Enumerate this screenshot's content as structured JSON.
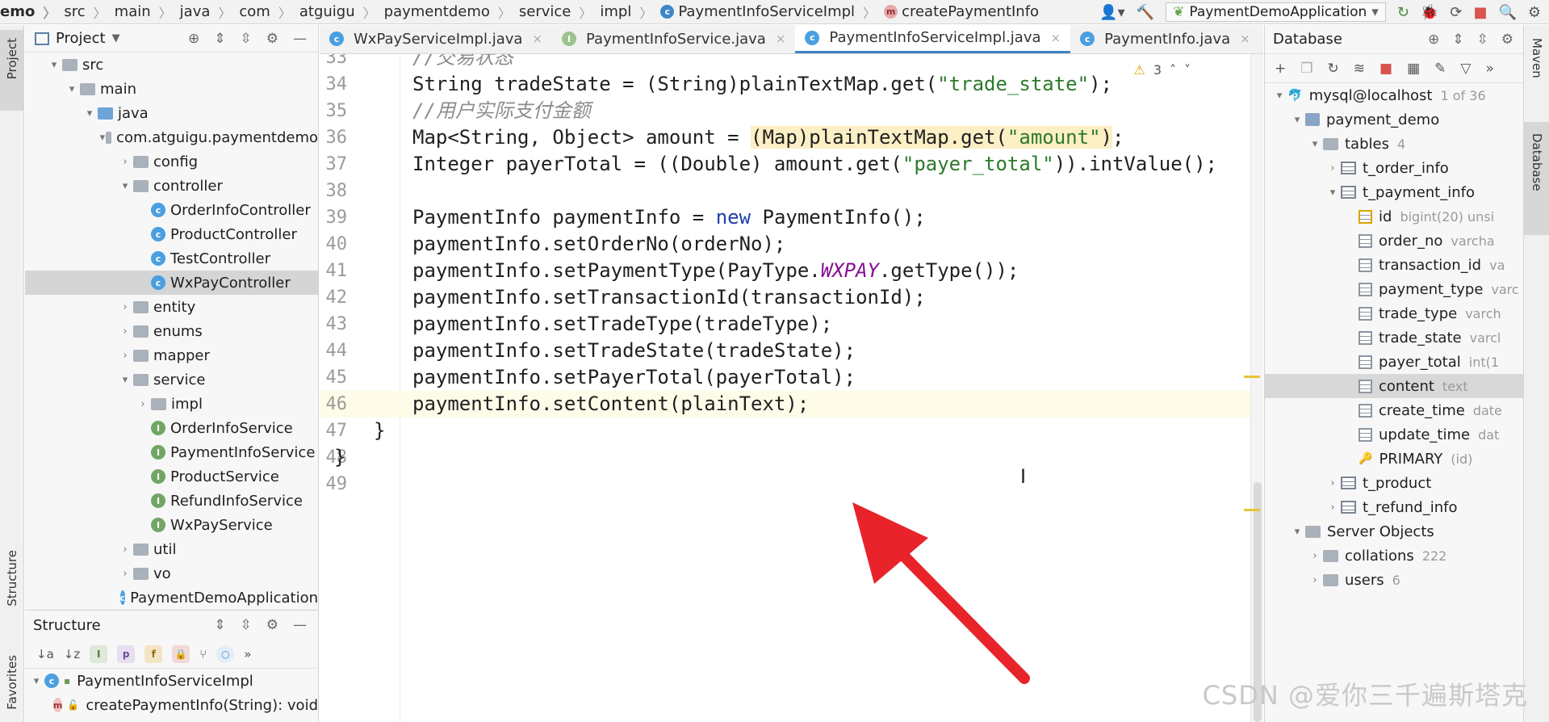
{
  "breadcrumb": [
    "emo",
    "src",
    "main",
    "java",
    "com",
    "atguigu",
    "paymentdemo",
    "service",
    "impl",
    "PaymentInfoServiceImpl",
    "createPaymentInfo"
  ],
  "run_config": "PaymentDemoApplication",
  "left_strip": {
    "project": "Project",
    "structure": "Structure",
    "favorites": "Favorites"
  },
  "right_strip": {
    "maven": "Maven",
    "database": "Database"
  },
  "project_panel": {
    "title": "Project",
    "tree": [
      {
        "label": "src",
        "depth": 0,
        "expanded": true,
        "kind": "folder"
      },
      {
        "label": "main",
        "depth": 1,
        "expanded": true,
        "kind": "folder"
      },
      {
        "label": "java",
        "depth": 2,
        "expanded": true,
        "kind": "folder-blue"
      },
      {
        "label": "com.atguigu.paymentdemo",
        "depth": 3,
        "expanded": true,
        "kind": "package"
      },
      {
        "label": "config",
        "depth": 4,
        "expanded": false,
        "kind": "package"
      },
      {
        "label": "controller",
        "depth": 4,
        "expanded": true,
        "kind": "package"
      },
      {
        "label": "OrderInfoController",
        "depth": 5,
        "kind": "class"
      },
      {
        "label": "ProductController",
        "depth": 5,
        "kind": "class"
      },
      {
        "label": "TestController",
        "depth": 5,
        "kind": "class"
      },
      {
        "label": "WxPayController",
        "depth": 5,
        "kind": "class",
        "selected": true
      },
      {
        "label": "entity",
        "depth": 4,
        "expanded": false,
        "kind": "package"
      },
      {
        "label": "enums",
        "depth": 4,
        "expanded": false,
        "kind": "package"
      },
      {
        "label": "mapper",
        "depth": 4,
        "expanded": false,
        "kind": "package"
      },
      {
        "label": "service",
        "depth": 4,
        "expanded": true,
        "kind": "package"
      },
      {
        "label": "impl",
        "depth": 5,
        "expanded": false,
        "kind": "package"
      },
      {
        "label": "OrderInfoService",
        "depth": 5,
        "kind": "interface"
      },
      {
        "label": "PaymentInfoService",
        "depth": 5,
        "kind": "interface"
      },
      {
        "label": "ProductService",
        "depth": 5,
        "kind": "interface"
      },
      {
        "label": "RefundInfoService",
        "depth": 5,
        "kind": "interface"
      },
      {
        "label": "WxPayService",
        "depth": 5,
        "kind": "interface"
      },
      {
        "label": "util",
        "depth": 4,
        "expanded": false,
        "kind": "package"
      },
      {
        "label": "vo",
        "depth": 4,
        "expanded": false,
        "kind": "package"
      },
      {
        "label": "PaymentDemoApplication",
        "depth": 4,
        "kind": "class"
      }
    ]
  },
  "structure_panel": {
    "title": "Structure",
    "items": [
      {
        "label": "PaymentInfoServiceImpl",
        "depth": 0,
        "kind": "class"
      },
      {
        "label": "createPaymentInfo(String): void",
        "depth": 1,
        "kind": "method"
      }
    ]
  },
  "editor_tabs": [
    {
      "label": "WxPayServiceImpl.java",
      "icon": "class"
    },
    {
      "label": "PaymentInfoService.java",
      "icon": "interface"
    },
    {
      "label": "PaymentInfoServiceImpl.java",
      "icon": "class",
      "active": true
    },
    {
      "label": "PaymentInfo.java",
      "icon": "class"
    }
  ],
  "editor": {
    "warnings_count": "3",
    "lines": [
      {
        "n": "33",
        "text": "//交易状态"
      },
      {
        "n": "34",
        "text": "String tradeState = (String)plainTextMap.get(\"trade_state\");"
      },
      {
        "n": "35",
        "text": "//用户实际支付金额"
      },
      {
        "n": "36",
        "text": "Map<String, Object> amount = (Map)plainTextMap.get(\"amount\");"
      },
      {
        "n": "37",
        "text": "Integer payerTotal = ((Double) amount.get(\"payer_total\")).intValue();"
      },
      {
        "n": "38",
        "text": ""
      },
      {
        "n": "39",
        "text": "PaymentInfo paymentInfo = new PaymentInfo();"
      },
      {
        "n": "40",
        "text": "paymentInfo.setOrderNo(orderNo);"
      },
      {
        "n": "41",
        "text": "paymentInfo.setPaymentType(PayType.WXPAY.getType());"
      },
      {
        "n": "42",
        "text": "paymentInfo.setTransactionId(transactionId);"
      },
      {
        "n": "43",
        "text": "paymentInfo.setTradeType(tradeType);"
      },
      {
        "n": "44",
        "text": "paymentInfo.setTradeState(tradeState);"
      },
      {
        "n": "45",
        "text": "paymentInfo.setPayerTotal(payerTotal);"
      },
      {
        "n": "46",
        "text": "paymentInfo.setContent(plainText);"
      },
      {
        "n": "47",
        "text": "}"
      },
      {
        "n": "48",
        "text": "}"
      },
      {
        "n": "49",
        "text": ""
      }
    ]
  },
  "database_panel": {
    "title": "Database",
    "tree": [
      {
        "label": "mysql@localhost",
        "meta": "1 of 36",
        "depth": 0,
        "expanded": true,
        "kind": "db"
      },
      {
        "label": "payment_demo",
        "meta": "",
        "depth": 1,
        "expanded": true,
        "kind": "schema"
      },
      {
        "label": "tables",
        "meta": "4",
        "depth": 2,
        "expanded": true,
        "kind": "folder"
      },
      {
        "label": "t_order_info",
        "meta": "",
        "depth": 3,
        "expanded": false,
        "kind": "table"
      },
      {
        "label": "t_payment_info",
        "meta": "",
        "depth": 3,
        "expanded": true,
        "kind": "table"
      },
      {
        "label": "id",
        "meta": "bigint(20) unsi",
        "depth": 4,
        "kind": "key-column"
      },
      {
        "label": "order_no",
        "meta": "varcha",
        "depth": 4,
        "kind": "column"
      },
      {
        "label": "transaction_id",
        "meta": "va",
        "depth": 4,
        "kind": "column"
      },
      {
        "label": "payment_type",
        "meta": "varc",
        "depth": 4,
        "kind": "column"
      },
      {
        "label": "trade_type",
        "meta": "varch",
        "depth": 4,
        "kind": "column"
      },
      {
        "label": "trade_state",
        "meta": "varcl",
        "depth": 4,
        "kind": "column"
      },
      {
        "label": "payer_total",
        "meta": "int(1",
        "depth": 4,
        "kind": "column"
      },
      {
        "label": "content",
        "meta": "text",
        "depth": 4,
        "kind": "column",
        "selected": true
      },
      {
        "label": "create_time",
        "meta": "date",
        "depth": 4,
        "kind": "column"
      },
      {
        "label": "update_time",
        "meta": "dat",
        "depth": 4,
        "kind": "column"
      },
      {
        "label": "PRIMARY",
        "meta": "(id)",
        "depth": 4,
        "kind": "key"
      },
      {
        "label": "t_product",
        "meta": "",
        "depth": 3,
        "expanded": false,
        "kind": "table"
      },
      {
        "label": "t_refund_info",
        "meta": "",
        "depth": 3,
        "expanded": false,
        "kind": "table"
      },
      {
        "label": "Server Objects",
        "meta": "",
        "depth": 1,
        "expanded": true,
        "kind": "folder"
      },
      {
        "label": "collations",
        "meta": "222",
        "depth": 2,
        "expanded": false,
        "kind": "folder"
      },
      {
        "label": "users",
        "meta": "6",
        "depth": 2,
        "expanded": false,
        "kind": "folder"
      }
    ]
  },
  "watermark": "CSDN @爱你三千遍斯塔克",
  "colors": {
    "accent": "#4083c9",
    "annotation_arrow": "#e8242a",
    "string": "#2c7a2c",
    "keyword": "#1f3fa8"
  }
}
